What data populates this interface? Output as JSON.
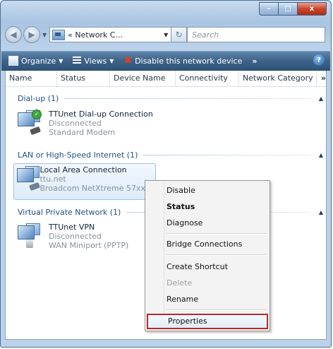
{
  "window": {
    "minimize": "–",
    "maximize": "□",
    "close": "x"
  },
  "nav": {
    "back": "◀",
    "forward": "▶",
    "address": "« Network C...",
    "refresh": "↻",
    "search_placeholder": "Search"
  },
  "toolbar": {
    "organize": "Organize",
    "views": "Views",
    "disable": "Disable this network device",
    "more": "»",
    "help": "?"
  },
  "columns": [
    "Name",
    "Status",
    "Device Name",
    "Connectivity",
    "Network Category",
    "»"
  ],
  "groups": [
    {
      "label": "Dial-up (1)"
    },
    {
      "label": "LAN or High-Speed Internet (1)"
    },
    {
      "label": "Virtual Private Network (1)"
    }
  ],
  "items": [
    {
      "name": "TTUnet Dial-up Connection",
      "status": "Disconnected",
      "device": "Standard Modem"
    },
    {
      "name": "Local Area Connection",
      "status": "ttu.net",
      "device": "Broadcom NetXtreme 57xx ..."
    },
    {
      "name": "TTUnet VPN",
      "status": "Disconnected",
      "device": "WAN Miniport (PPTP)"
    }
  ],
  "context_menu": [
    {
      "label": "Disable"
    },
    {
      "label": "Status"
    },
    {
      "label": "Diagnose"
    },
    {
      "label": "Bridge Connections"
    },
    {
      "label": "Create Shortcut"
    },
    {
      "label": "Delete"
    },
    {
      "label": "Rename"
    },
    {
      "label": "Properties"
    }
  ],
  "colors": {
    "toolbar_bg": "#3e6288",
    "group_text": "#1f4f86",
    "highlight_border": "#b62b2b"
  }
}
